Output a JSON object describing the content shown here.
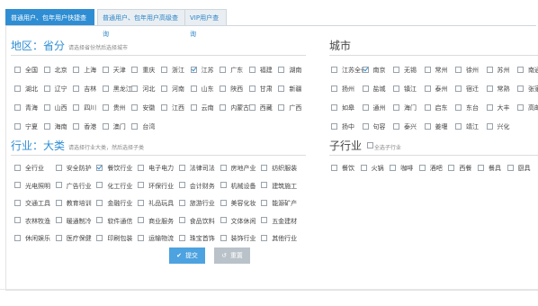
{
  "tabs": [
    {
      "label": "普通用户、包年用户快捷查询"
    },
    {
      "label": "普通用户、包年用户高级查询"
    },
    {
      "label": "VIP用户查询"
    }
  ],
  "region": {
    "title": "地区：省分",
    "hint": "请选择省份然后选择城市",
    "provinces": [
      [
        "全国",
        "北京",
        "上海",
        "天津",
        "重庆",
        "浙江",
        "江苏",
        "广东",
        "福建",
        "湖南"
      ],
      [
        "湖北",
        "辽宁",
        "吉林",
        "黑龙江",
        "河北",
        "河南",
        "山东",
        "陕西",
        "甘肃",
        "新疆"
      ],
      [
        "青海",
        "山西",
        "四川",
        "贵州",
        "安徽",
        "江西",
        "云南",
        "内蒙古",
        "西藏",
        "广西"
      ],
      [
        "宁夏",
        "海南",
        "香港",
        "澳门",
        "台湾"
      ]
    ],
    "checked": [
      "江苏"
    ]
  },
  "city": {
    "title": "城市",
    "cities": [
      [
        "江苏全省",
        "南京",
        "无锡",
        "常州",
        "徐州",
        "苏州",
        "南通"
      ],
      [
        "扬州",
        "盐城",
        "镇江",
        "泰州",
        "宿迁",
        "常熟",
        "张家港"
      ],
      [
        "如皋",
        "通州",
        "海门",
        "启东",
        "东台",
        "大丰",
        "高邮"
      ],
      [
        "扬中",
        "句容",
        "泰兴",
        "姜堰",
        "靖江",
        "兴化"
      ]
    ],
    "checked": [
      "南京"
    ]
  },
  "industry": {
    "title": "行业：大类",
    "hint": "请选择行业大类，然后选择子类",
    "items": [
      [
        "全行业",
        "安全防护",
        "餐饮行业",
        "电子电力",
        "法律司法",
        "房地产业",
        "纺织服装"
      ],
      [
        "光电照明",
        "广告行业",
        "化工行业",
        "环保行业",
        "会计财务",
        "机械设备",
        "建筑施工"
      ],
      [
        "交通工具",
        "教育培训",
        "金融行业",
        "礼品玩具",
        "旅游行业",
        "美容化妆",
        "能源矿产"
      ],
      [
        "农林牧渔",
        "暖通制冷",
        "软件通信",
        "商业服务",
        "食品饮料",
        "文体休闲",
        "五金建材"
      ],
      [
        "休闲娱乐",
        "医疗保健",
        "印刷包装",
        "运输物流",
        "珠宝首饰",
        "装饰行业",
        "其他行业"
      ]
    ],
    "checked": [
      "餐饮行业"
    ]
  },
  "subindustry": {
    "title": "子行业",
    "select_all": "全选子行业",
    "items": [
      "餐饮",
      "火锅",
      "咖啡",
      "酒吧",
      "西餐",
      "餐具",
      "厨具"
    ]
  },
  "buttons": {
    "submit": "提交",
    "reset": "重置",
    "submit_icon": "✔",
    "reset_icon": "↺"
  },
  "colors": {
    "accent": "#2f8ed3",
    "submit": "#4da2e0",
    "reset": "#b9c2c9"
  }
}
